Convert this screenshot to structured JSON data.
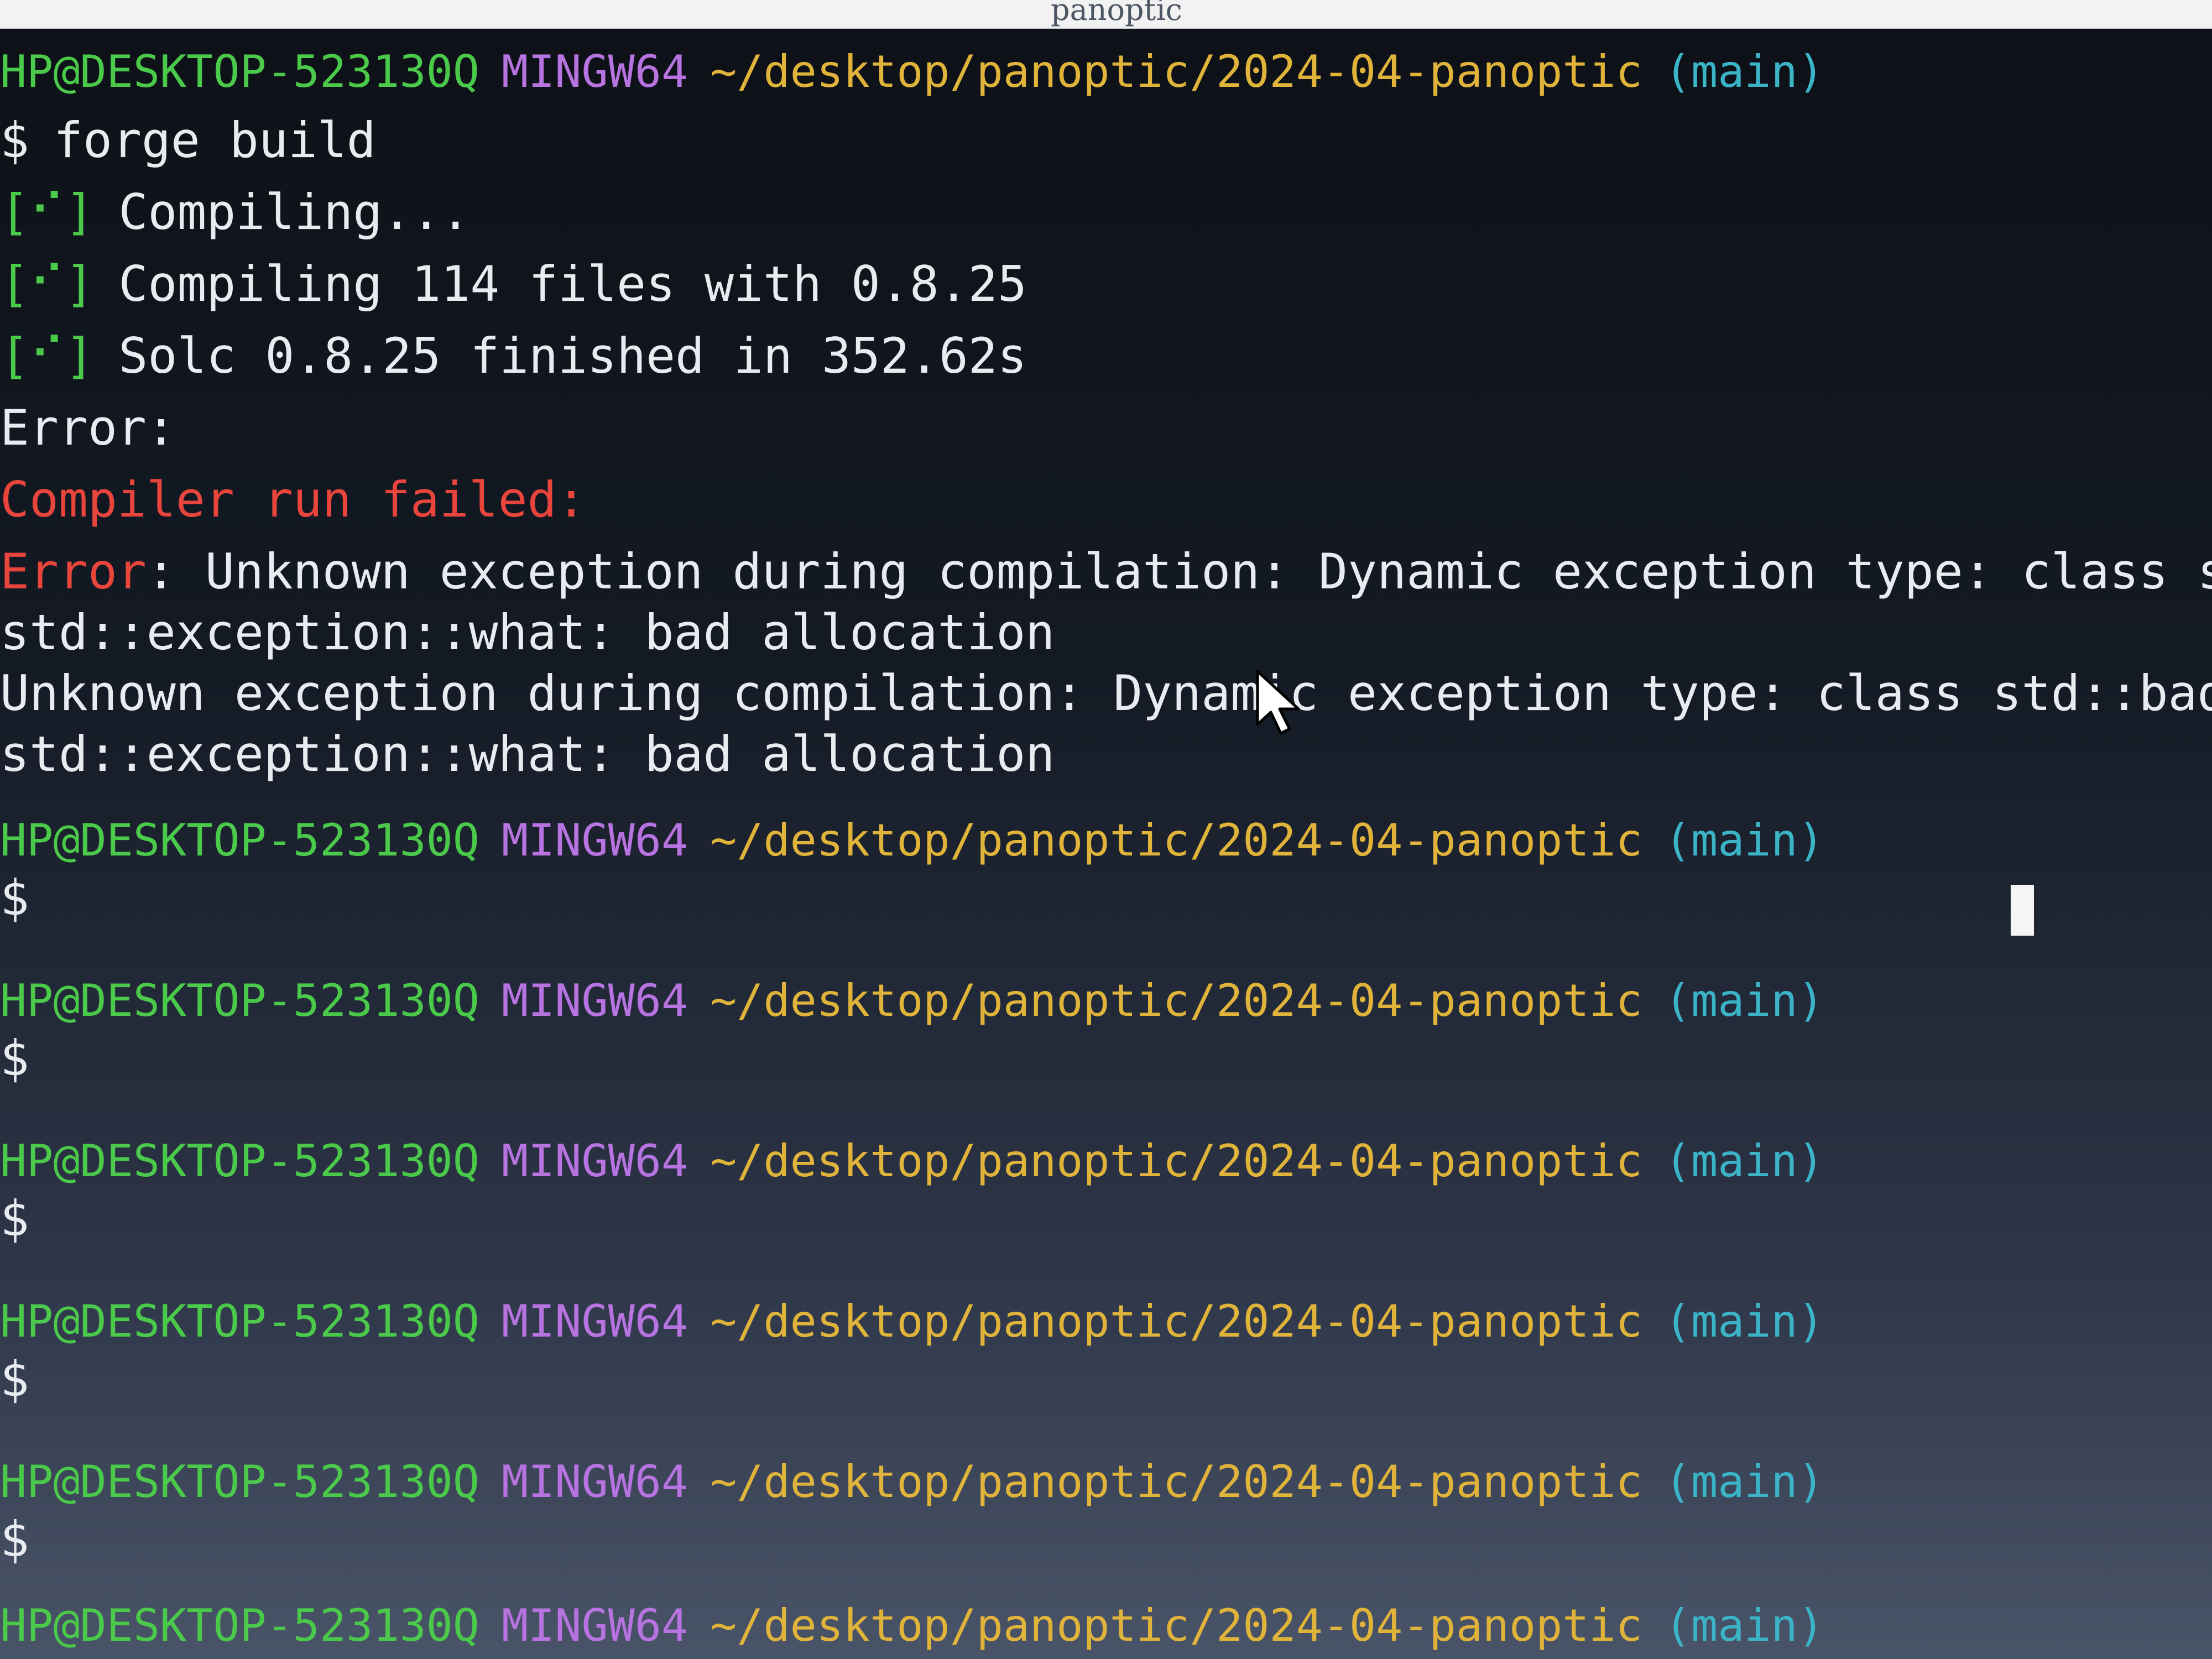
{
  "window": {
    "title": "panoptic"
  },
  "prompt": {
    "user_host": "HP@DESKTOP-523130Q",
    "system": "MINGW64",
    "path": "~/desktop/panoptic/2024-04-panoptic",
    "branch": "(main)",
    "symbol": "$"
  },
  "command": "forge build",
  "output": {
    "status_marker": "[⠊]",
    "compiling": "Compiling...",
    "compiling_files": "Compiling 114 files with 0.8.25",
    "solc_finished": "Solc 0.8.25 finished in 352.62s",
    "error_header": "Error:",
    "compiler_failed": "Compiler run failed:",
    "error_label": "Error",
    "error_message": ": Unknown exception during compilation: Dynamic exception type: class std::bad_alloc",
    "what_1": "std::exception::what: bad allocation",
    "unknown_exception": "Unknown exception during compilation: Dynamic exception type: class std::bad_alloc",
    "what_2": "std::exception::what: bad allocation"
  },
  "colors": {
    "user_host": "#4ac94a",
    "system": "#b773e0",
    "path": "#e0b43a",
    "branch": "#3cb4c8",
    "error": "#e8453c",
    "text": "#e8ebf0"
  }
}
